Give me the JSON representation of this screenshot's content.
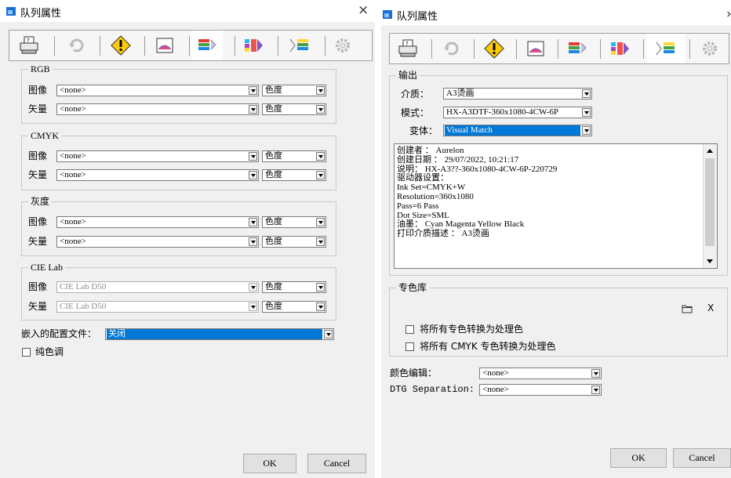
{
  "left_dialog": {
    "title": "队列属性",
    "close_label": "×",
    "rgb": {
      "legend": "RGB",
      "image_label": "图像",
      "image_value": "<none>",
      "image_mode": "色度",
      "vector_label": "矢量",
      "vector_value": "<none>",
      "vector_mode": "色度"
    },
    "cmyk": {
      "legend": "CMYK",
      "image_label": "图像",
      "image_value": "<none>",
      "image_mode": "色度",
      "vector_label": "矢量",
      "vector_value": "<none>",
      "vector_mode": "色度"
    },
    "gray": {
      "legend": "灰度",
      "image_label": "图像",
      "image_value": "<none>",
      "image_mode": "色度",
      "vector_label": "矢量",
      "vector_value": "<none>",
      "vector_mode": "色度"
    },
    "cielab": {
      "legend": "CIE Lab",
      "image_label": "图像",
      "image_value": "CIE Lab D50",
      "image_mode": "色度",
      "vector_label": "矢量",
      "vector_value": "CIE Lab D50",
      "vector_mode": "色度"
    },
    "embed_label": "嵌入的配置文件：",
    "embed_value": "关闭",
    "pure_tone_label": "纯色调",
    "ok_label": "OK",
    "cancel_label": "Cancel"
  },
  "right_dialog": {
    "title": "队列属性",
    "output": {
      "legend": "输出",
      "media_label": "介质：",
      "media_value": "A3烫画",
      "mode_label": "模式：",
      "mode_value": "HX-A3DTF-360x1080-4CW-6P",
      "variant_label": "变体：",
      "variant_value": "Visual Match",
      "info_lines": [
        "创建者 ： Aurelon",
        "创建日期 ： 29/07/2022, 10:21:17",
        "说明： HX-A3??-360x1080-4CW-6P-220729",
        "驱动器设置：",
        "Ink Set=CMYK+W",
        "Resolution=360x1080",
        "Pass=6 Pass",
        "Dot Size=SML",
        "油墨： Cyan Magenta Yellow Black",
        "打印介质描述 ： A3烫画"
      ]
    },
    "spot": {
      "legend": "专色库",
      "delete_label": "X",
      "convert_all_label": "将所有专色转换为处理色",
      "convert_cmyk_label": "将所有 CMYK 专色转换为处理色"
    },
    "color_edit_label": "颜色编辑：",
    "color_edit_value": "<none>",
    "dtg_label": "DTG Separation:",
    "dtg_value": "<none>",
    "ok_label": "OK",
    "cancel_label": "Cancel"
  },
  "tabs": [
    "printer-icon",
    "rotate-icon",
    "warning-icon",
    "media-icon",
    "color-output-icon",
    "color-separation-icon",
    "color-tail-icon",
    "gear-icon"
  ],
  "colors": {
    "selection": "#0078d7",
    "window_bg": "#f0f0f0",
    "icon_blue": "#1a6fd6"
  }
}
